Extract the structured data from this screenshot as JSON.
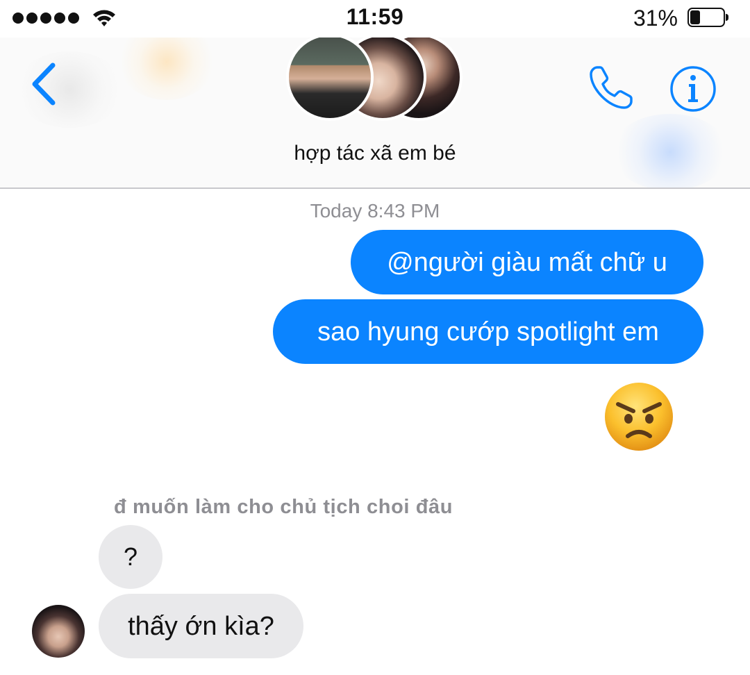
{
  "status_bar": {
    "time": "11:59",
    "battery_percent": "31%",
    "battery_level": 0.31,
    "signal_bars": 5
  },
  "header": {
    "group_name": "hợp tác xã em bé",
    "back_icon": "chevron-left-icon",
    "call_icon": "phone-icon",
    "info_icon": "info-icon",
    "accent_color": "#0b84ff"
  },
  "conversation": {
    "timestamp": "Today 8:43 PM",
    "messages": [
      {
        "direction": "outgoing",
        "text": "@người giàu mất chữ u"
      },
      {
        "direction": "outgoing",
        "text": "sao hyung cướp spotlight em"
      },
      {
        "direction": "outgoing",
        "emoji": "angry-face"
      },
      {
        "direction": "incoming",
        "reply_to": "đ muốn làm cho chủ tịch choi đâu",
        "text": "?"
      },
      {
        "direction": "incoming",
        "text": "thấy ớn kìa?"
      }
    ]
  },
  "colors": {
    "outgoing_bubble": "#0b84ff",
    "incoming_bubble": "#e9e9eb",
    "secondary_text": "#8e8e93"
  }
}
